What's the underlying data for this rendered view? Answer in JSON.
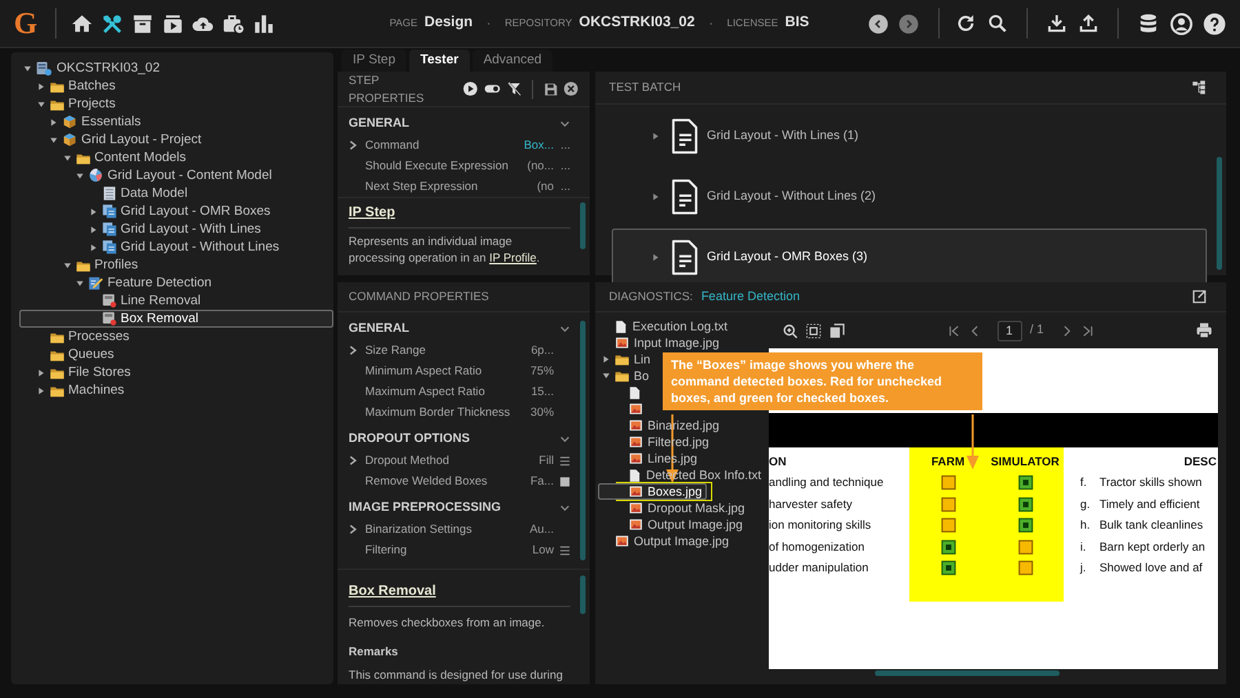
{
  "topbar": {
    "logo": "G",
    "nav": [
      {
        "selected": false
      },
      {
        "selected": true
      },
      {
        "selected": false
      },
      {
        "selected": false
      },
      {
        "selected": false
      },
      {
        "selected": false
      },
      {
        "selected": false
      }
    ],
    "info": [
      {
        "label": "PAGE",
        "value": "Design"
      },
      {
        "label": "REPOSITORY",
        "value": "OKCSTRKI03_02"
      },
      {
        "label": "LICENSEE",
        "value": "BIS"
      }
    ],
    "separator": "·"
  },
  "tree": [
    {
      "label": "OKCSTRKI03_02",
      "kind": "server",
      "expanded": true,
      "selected": false,
      "children": [
        {
          "label": "Batches",
          "kind": "folder",
          "expanded": false,
          "selected": false
        },
        {
          "label": "Projects",
          "kind": "folder",
          "expanded": true,
          "selected": false,
          "children": [
            {
              "label": "Essentials",
              "kind": "cube",
              "expanded": false,
              "selected": false
            },
            {
              "label": "Grid Layout - Project",
              "kind": "cube",
              "expanded": true,
              "selected": false,
              "children": [
                {
                  "label": "Content Models",
                  "kind": "folder",
                  "expanded": true,
                  "selected": false,
                  "children": [
                    {
                      "label": "Grid Layout - Content Model",
                      "kind": "model",
                      "expanded": true,
                      "selected": false,
                      "children": [
                        {
                          "label": "Data Model",
                          "kind": "table",
                          "selected": false
                        },
                        {
                          "label": "Grid Layout - OMR Boxes",
                          "kind": "docs",
                          "expanded": false,
                          "selected": false
                        },
                        {
                          "label": "Grid Layout - With Lines",
                          "kind": "docs",
                          "expanded": false,
                          "selected": false
                        },
                        {
                          "label": "Grid Layout - Without Lines",
                          "kind": "docs",
                          "expanded": false,
                          "selected": false
                        }
                      ]
                    }
                  ]
                },
                {
                  "label": "Profiles",
                  "kind": "folder",
                  "expanded": true,
                  "selected": false,
                  "children": [
                    {
                      "label": "Feature Detection",
                      "kind": "profile",
                      "expanded": true,
                      "selected": false,
                      "children": [
                        {
                          "label": "Line Removal",
                          "kind": "step",
                          "selected": false
                        },
                        {
                          "label": "Box Removal",
                          "kind": "step",
                          "selected": true
                        }
                      ]
                    }
                  ]
                }
              ]
            }
          ]
        },
        {
          "label": "Processes",
          "kind": "folder",
          "selected": false
        },
        {
          "label": "Queues",
          "kind": "folder",
          "selected": false
        },
        {
          "label": "File Stores",
          "kind": "folder",
          "expanded": false,
          "selected": false
        },
        {
          "label": "Machines",
          "kind": "folder",
          "expanded": false,
          "selected": false
        }
      ]
    }
  ],
  "tabs": [
    {
      "label": "IP Step",
      "selected": false
    },
    {
      "label": "Tester",
      "selected": true
    },
    {
      "label": "Advanced",
      "selected": false
    }
  ],
  "step_properties": {
    "title": "STEP PROPERTIES",
    "sections": [
      {
        "title": "GENERAL",
        "expanded": true,
        "rows": [
          {
            "name": "Command",
            "value": "Box...",
            "expandable": true,
            "link": true,
            "kind": "ellipsis",
            "button": "..."
          },
          {
            "name": "Should Execute Expression",
            "value": "(no...",
            "expandable": false,
            "link": false,
            "kind": "ellipsis",
            "button": "..."
          },
          {
            "name": "Next Step Expression",
            "value": "(no",
            "expandable": false,
            "link": false,
            "kind": "ellipsis",
            "button": "..."
          }
        ]
      }
    ],
    "help": {
      "title": "IP Step",
      "text": "Represents an individual image processing operation in an ",
      "link": "IP Profile",
      "after": "."
    }
  },
  "command_properties": {
    "title": "COMMAND PROPERTIES",
    "sections": [
      {
        "title": "GENERAL",
        "expanded": true,
        "rows": [
          {
            "name": "Size Range",
            "value": "6p...",
            "expandable": true,
            "link": false,
            "kind": "plain"
          },
          {
            "name": "Minimum Aspect Ratio",
            "value": "75%",
            "expandable": false,
            "link": false,
            "kind": "plain"
          },
          {
            "name": "Maximum Aspect Ratio",
            "value": "15...",
            "expandable": false,
            "link": false,
            "kind": "plain"
          },
          {
            "name": "Maximum Border Thickness",
            "value": "30%",
            "expandable": false,
            "link": false,
            "kind": "plain"
          }
        ]
      },
      {
        "title": "DROPOUT OPTIONS",
        "expanded": true,
        "rows": [
          {
            "name": "Dropout Method",
            "value": "Fill",
            "expandable": true,
            "link": false,
            "kind": "list"
          },
          {
            "name": "Remove Welded Boxes",
            "value": "Fa...",
            "expandable": false,
            "link": false,
            "kind": "checkbox",
            "checked": false
          }
        ]
      },
      {
        "title": "IMAGE PREPROCESSING",
        "expanded": true,
        "rows": [
          {
            "name": "Binarization Settings",
            "value": "Au...",
            "expandable": true,
            "link": false,
            "kind": "plain"
          },
          {
            "name": "Filtering",
            "value": "Low",
            "expandable": false,
            "link": false,
            "kind": "list"
          }
        ]
      }
    ],
    "help": {
      "title": "Box Removal",
      "text": "Removes checkboxes from an image.",
      "remarks_title": "Remarks",
      "remarks": "This command is designed for use during"
    }
  },
  "test_batch": {
    "title": "TEST BATCH",
    "items": [
      {
        "label": "Grid Layout - With Lines (1)",
        "selected": false
      },
      {
        "label": "Grid Layout - Without Lines (2)",
        "selected": false
      },
      {
        "label": "Grid Layout - OMR Boxes (3)",
        "selected": true
      }
    ]
  },
  "diagnostics": {
    "title": "DIAGNOSTICS:",
    "link": "Feature Detection",
    "files": [
      {
        "label": "Execution Log.txt",
        "kind": "file",
        "selected": false
      },
      {
        "label": "Input Image.jpg",
        "kind": "image",
        "selected": false
      },
      {
        "label": "Lin",
        "kind": "folder",
        "expanded": false,
        "selected": false
      },
      {
        "label": "Bo",
        "kind": "folder",
        "expanded": true,
        "selected": false,
        "children": [
          {
            "kind": "file",
            "selected": false
          },
          {
            "kind": "image",
            "selected": false
          },
          {
            "label": "Binarized.jpg",
            "kind": "image",
            "selected": false
          },
          {
            "label": "Filtered.jpg",
            "kind": "image",
            "selected": false
          },
          {
            "label": "Lines.jpg",
            "kind": "image",
            "selected": false
          },
          {
            "label": "Detected Box Info.txt",
            "kind": "file",
            "selected": false
          },
          {
            "label": "Boxes.jpg",
            "kind": "image",
            "selected": true
          },
          {
            "label": "Dropout Mask.jpg",
            "kind": "image",
            "selected": false
          },
          {
            "label": "Output Image.jpg",
            "kind": "image",
            "selected": false
          }
        ]
      },
      {
        "label": "Output Image.jpg",
        "kind": "image",
        "selected": false
      }
    ],
    "viewer": {
      "page": "1",
      "total": "/ 1"
    },
    "document": {
      "columns": [
        "ON",
        "FARM",
        "SIMULATOR",
        "DESC"
      ],
      "rows": [
        {
          "left": "andling and technique",
          "farm": false,
          "simulator": true,
          "letter": "f.",
          "right": "Tractor skills shown"
        },
        {
          "left": "harvester safety",
          "farm": false,
          "simulator": true,
          "letter": "g.",
          "right": "Timely and efficient"
        },
        {
          "left": "ion monitoring skills",
          "farm": false,
          "simulator": true,
          "letter": "h.",
          "right": "Bulk tank cleanlines"
        },
        {
          "left": "of homogenization",
          "farm": true,
          "simulator": false,
          "letter": "i.",
          "right": "Barn kept orderly an"
        },
        {
          "left": "udder manipulation",
          "farm": true,
          "simulator": false,
          "letter": "j.",
          "right": "Showed love and af"
        }
      ]
    },
    "callout": "The “Boxes” image shows you where the command detected boxes. Red for unchecked boxes, and green for checked boxes."
  }
}
